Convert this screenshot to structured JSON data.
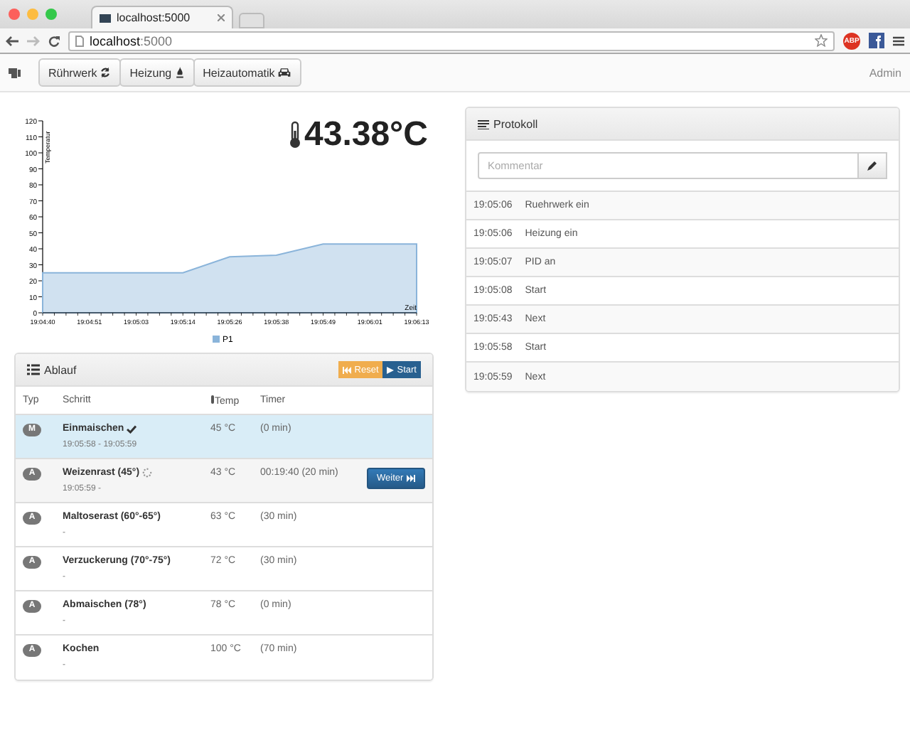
{
  "browser": {
    "tab_title": "localhost:5000",
    "url_host": "localhost",
    "url_port": ":5000",
    "adblock_label": "ABP"
  },
  "navbar": {
    "buttons": [
      {
        "label": "Rührwerk",
        "kind": "refresh"
      },
      {
        "label": "Heizung",
        "kind": "fire"
      },
      {
        "label": "Heizautomatik",
        "kind": "car"
      }
    ],
    "user": "Admin"
  },
  "temperature": "43.38°C",
  "chart_data": {
    "type": "area",
    "xlabel": "Zeit",
    "ylabel": "Temperatur",
    "categories": [
      "19:04:40",
      "19:04:51",
      "19:05:03",
      "19:05:14",
      "19:05:26",
      "19:05:38",
      "19:05:49",
      "19:06:01",
      "19:06:13"
    ],
    "series": [
      {
        "name": "P1",
        "color": "#8ab4da",
        "values": [
          25,
          25,
          25,
          25,
          35,
          36,
          43,
          43,
          43
        ]
      }
    ],
    "ylim": [
      0,
      120
    ],
    "yticks": [
      0,
      10,
      20,
      30,
      40,
      50,
      60,
      70,
      80,
      90,
      100,
      110,
      120
    ]
  },
  "ablauf": {
    "title": "Ablauf",
    "reset": "Reset",
    "start": "Start",
    "columns": [
      "Typ",
      "Schritt",
      "Temp",
      "Timer"
    ],
    "rows": [
      {
        "type": "M",
        "name": "Einmaischen",
        "kind": "done",
        "time": "19:05:58 - 19:05:59",
        "temp": "45 °C",
        "timer": "(0 min)"
      },
      {
        "type": "A",
        "name": "Weizenrast (45°)",
        "kind": "running",
        "time": "19:05:59 -",
        "temp": "43 °C",
        "timer": "00:19:40 (20 min)",
        "action": "Weiter"
      },
      {
        "type": "A",
        "name": "Maltoserast (60°-65°)",
        "kind": "pending",
        "time": "-",
        "temp": "63 °C",
        "timer": "(30 min)"
      },
      {
        "type": "A",
        "name": "Verzuckerung (70°-75°)",
        "kind": "pending",
        "time": "-",
        "temp": "72 °C",
        "timer": "(30 min)"
      },
      {
        "type": "A",
        "name": "Abmaischen (78°)",
        "kind": "pending",
        "time": "-",
        "temp": "78 °C",
        "timer": "(0 min)"
      },
      {
        "type": "A",
        "name": "Kochen",
        "kind": "pending",
        "time": "-",
        "temp": "100 °C",
        "timer": "(70 min)"
      }
    ]
  },
  "protokoll": {
    "title": "Protokoll",
    "placeholder": "Kommentar",
    "entries": [
      {
        "time": "19:05:06",
        "text": "Ruehrwerk ein"
      },
      {
        "time": "19:05:06",
        "text": "Heizung ein"
      },
      {
        "time": "19:05:07",
        "text": "PID an"
      },
      {
        "time": "19:05:08",
        "text": "Start"
      },
      {
        "time": "19:05:43",
        "text": "Next"
      },
      {
        "time": "19:05:58",
        "text": "Start"
      },
      {
        "time": "19:05:59",
        "text": "Next"
      }
    ]
  }
}
